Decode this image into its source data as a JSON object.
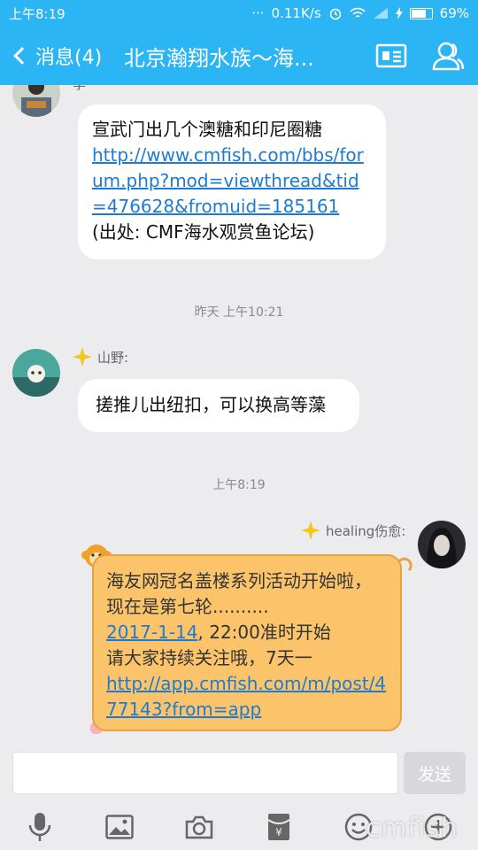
{
  "status": {
    "time": "上午8:19",
    "dots": "···",
    "network": "0.11K/s",
    "battery": "69%",
    "battery_level": 0.69
  },
  "header": {
    "back_label": "消息(4)",
    "title": "北京瀚翔水族～海..."
  },
  "chat": {
    "partial_sender": "李",
    "message1": {
      "text": "宣武门出几个澳糖和印尼圈糖",
      "link": "http://www.cmfish.com/bbs/forum.php?mod=viewthread&tid=476628&fromuid=185161",
      "source": "(出处: CMF海水观赏鱼论坛)"
    },
    "time1": "昨天 上午10:21",
    "message2": {
      "sender": "山野:",
      "text": "搓推儿出纽扣，可以换高等藻"
    },
    "time2": "上午8:19",
    "message3": {
      "sender": "healing伤愈:",
      "line1": "海友网冠名盖楼系列活动开始啦，现在是第七轮..........",
      "date_link": "2017-1-14",
      "line2": ", 22:00准时开始",
      "line3": "请大家持续关注哦，7天一",
      "link": "http://app.cmfish.com/m/post/477143?from=app"
    }
  },
  "input": {
    "placeholder": "",
    "send_label": "发送"
  },
  "watermark": "cmfish",
  "colors": {
    "accent": "#2bb5f4",
    "link": "#1f7bd0",
    "my_bubble": "#fbc46a"
  }
}
